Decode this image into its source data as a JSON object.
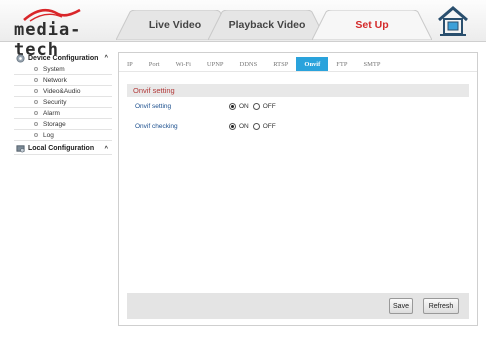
{
  "header": {
    "logo_text": "media-tech",
    "nav": [
      {
        "label": "Live Video"
      },
      {
        "label": "Playback Video"
      },
      {
        "label": "Set Up"
      }
    ],
    "home_icon": "home-icon",
    "active_color": "#d42a2a"
  },
  "sidebar": {
    "device_config": {
      "label": "Device Configuration",
      "caret": "^",
      "items": [
        "System",
        "Network",
        "Video&Audio",
        "Security",
        "Alarm",
        "Storage",
        "Log"
      ]
    },
    "local_config": {
      "label": "Local Configuration",
      "caret": "^"
    }
  },
  "content": {
    "subtabs": [
      "IP",
      "Port",
      "Wi-Fi",
      "UPNP",
      "DDNS",
      "RTSP",
      "Onvif",
      "FTP",
      "SMTP"
    ],
    "active_subtab": "Onvif",
    "active_color": "#2aa3dc",
    "section_title": "Onvif setting",
    "rows": [
      {
        "label": "Onvif setting",
        "on": "ON",
        "off": "OFF",
        "selected": "ON"
      },
      {
        "label": "Onvif checking",
        "on": "ON",
        "off": "OFF",
        "selected": "ON"
      }
    ],
    "buttons": {
      "save": "Save",
      "refresh": "Refresh"
    }
  }
}
